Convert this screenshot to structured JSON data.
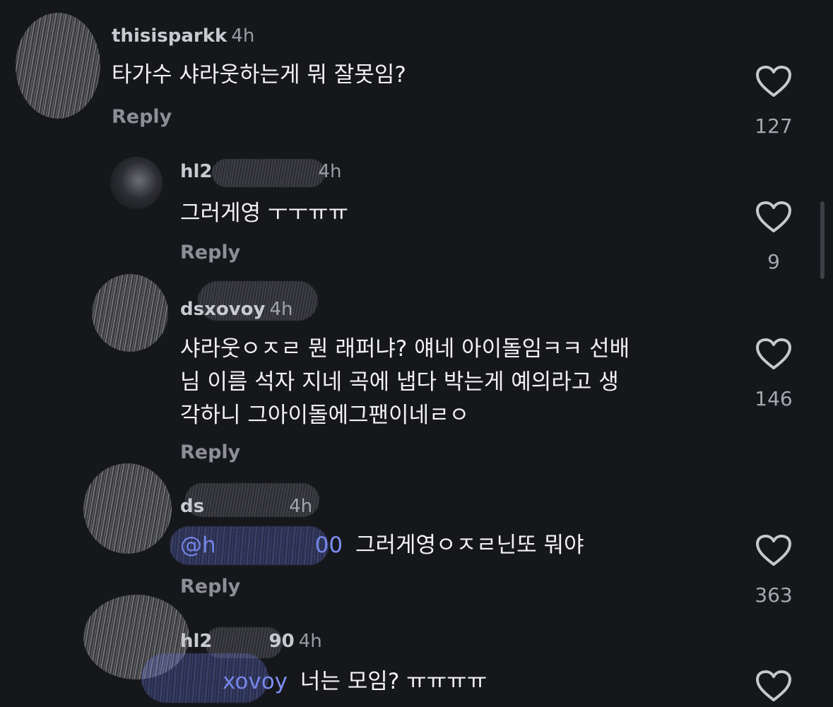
{
  "reply_label": "Reply",
  "like_icon": "heart-outline-icon",
  "colors": {
    "background": "#16171b",
    "text": "#f2f2f5",
    "username": "#c9cad0",
    "meta": "#8d8e96",
    "mention": "#7d8ff3"
  },
  "comments": [
    {
      "username": "thisisparkk",
      "time": "4h",
      "text": "타가수 샤라웃하는게 뭐 잘못임?",
      "likes": "127"
    },
    {
      "username": "hl2",
      "time": "4h",
      "text": "그러게영 ㅜㅜㅠㅠ",
      "likes": "9"
    },
    {
      "username": "dsxovoy",
      "time": "4h",
      "text_lines": [
        "샤라웃ㅇㅈㄹ 뭔 래퍼냐? 얘네 아이돌임ㅋㅋ 선배",
        "님 이름 석자 지네 곡에 냅다 박는게 예의라고 생",
        "각하니 그아이돌에그팬이네ㄹㅇ"
      ],
      "likes": "146"
    },
    {
      "username": "ds",
      "time": "4h",
      "mention": "@h",
      "mention_end": "00",
      "text": "그러게영ㅇㅈㄹ닌또 뭐야",
      "likes": "363"
    },
    {
      "username": "hl2",
      "username_end": "90",
      "time": "4h",
      "mention": "xovoy",
      "text": "너는 모임? ㅠㅠㅠㅠ"
    }
  ]
}
